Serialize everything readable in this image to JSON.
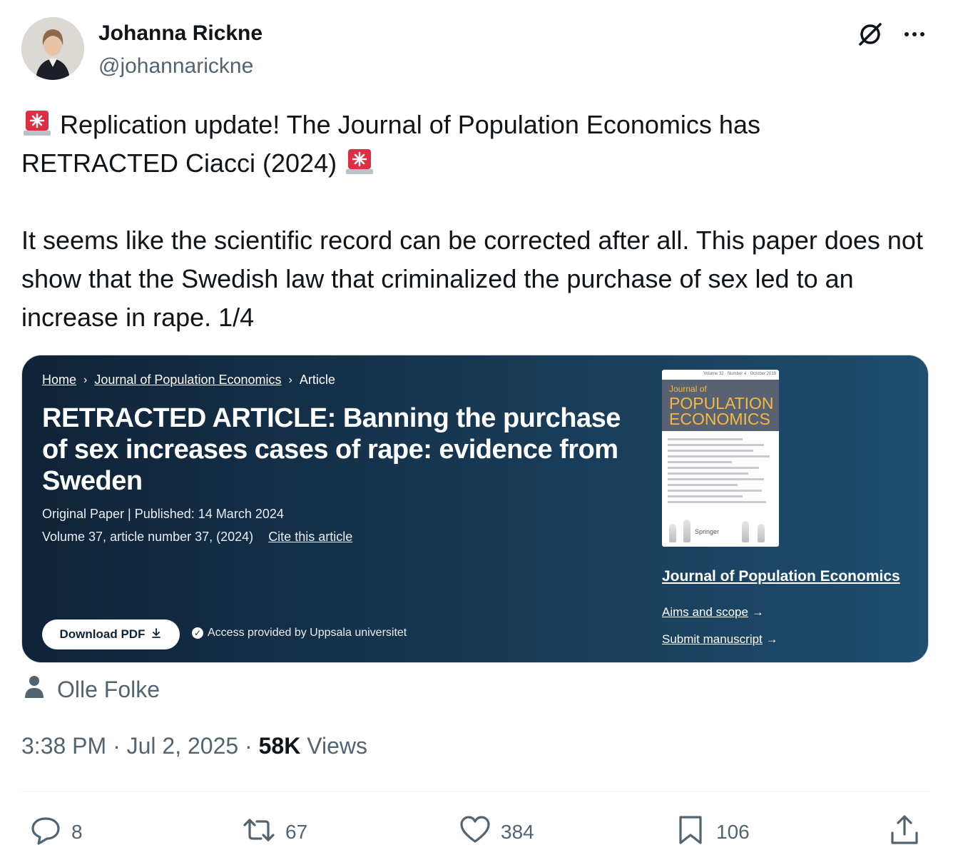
{
  "tweet": {
    "author_name": "Johanna Rickne",
    "author_handle": "@johannarickne",
    "text_line1": "Replication update! The Journal of Population Economics has",
    "text_line2": "RETRACTED Ciacci (2024)",
    "text_para2": "It seems like the scientific record can be corrected after all. This paper does not show that the Swedish law that criminalized the purchase of sex led to an increase in rape. 1/4",
    "tagged_user": "Olle Folke",
    "time": "3:38 PM · Jul 2, 2025 · ",
    "views_count": "58K",
    "views_label": " Views"
  },
  "media": {
    "breadcrumb": [
      "Home",
      "Journal of Population Economics",
      "Article"
    ],
    "title": "RETRACTED ARTICLE: Banning the purchase of sex increases cases of rape: evidence from Sweden",
    "meta_line1": "Original Paper | Published: 14 March 2024",
    "meta_line2": "Volume 37, article number 37, (2024)",
    "cite": "Cite this article",
    "download": "Download PDF",
    "access": "Access provided by Uppsala universitet",
    "cover_vol": "Volume 32 · Number 4 · October 2019",
    "cover_journal_of": "Journal of",
    "cover_title_1": "POPULATION",
    "cover_title_2": "ECONOMICS",
    "cover_publisher": "Springer",
    "journal_link": "Journal of Population Economics",
    "aims": "Aims and scope",
    "submit": "Submit manuscript"
  },
  "actions": {
    "replies": "8",
    "reposts": "67",
    "likes": "384",
    "bookmarks": "106"
  },
  "icons": [
    "siren-icon",
    "grok-icon",
    "more-icon",
    "person-icon",
    "reply-icon",
    "repost-icon",
    "like-icon",
    "bookmark-icon",
    "share-icon"
  ],
  "colors": {
    "text": "#0f1419",
    "secondary": "#536471",
    "card_bg": "#183a55",
    "cover_gold": "#f4b942"
  }
}
